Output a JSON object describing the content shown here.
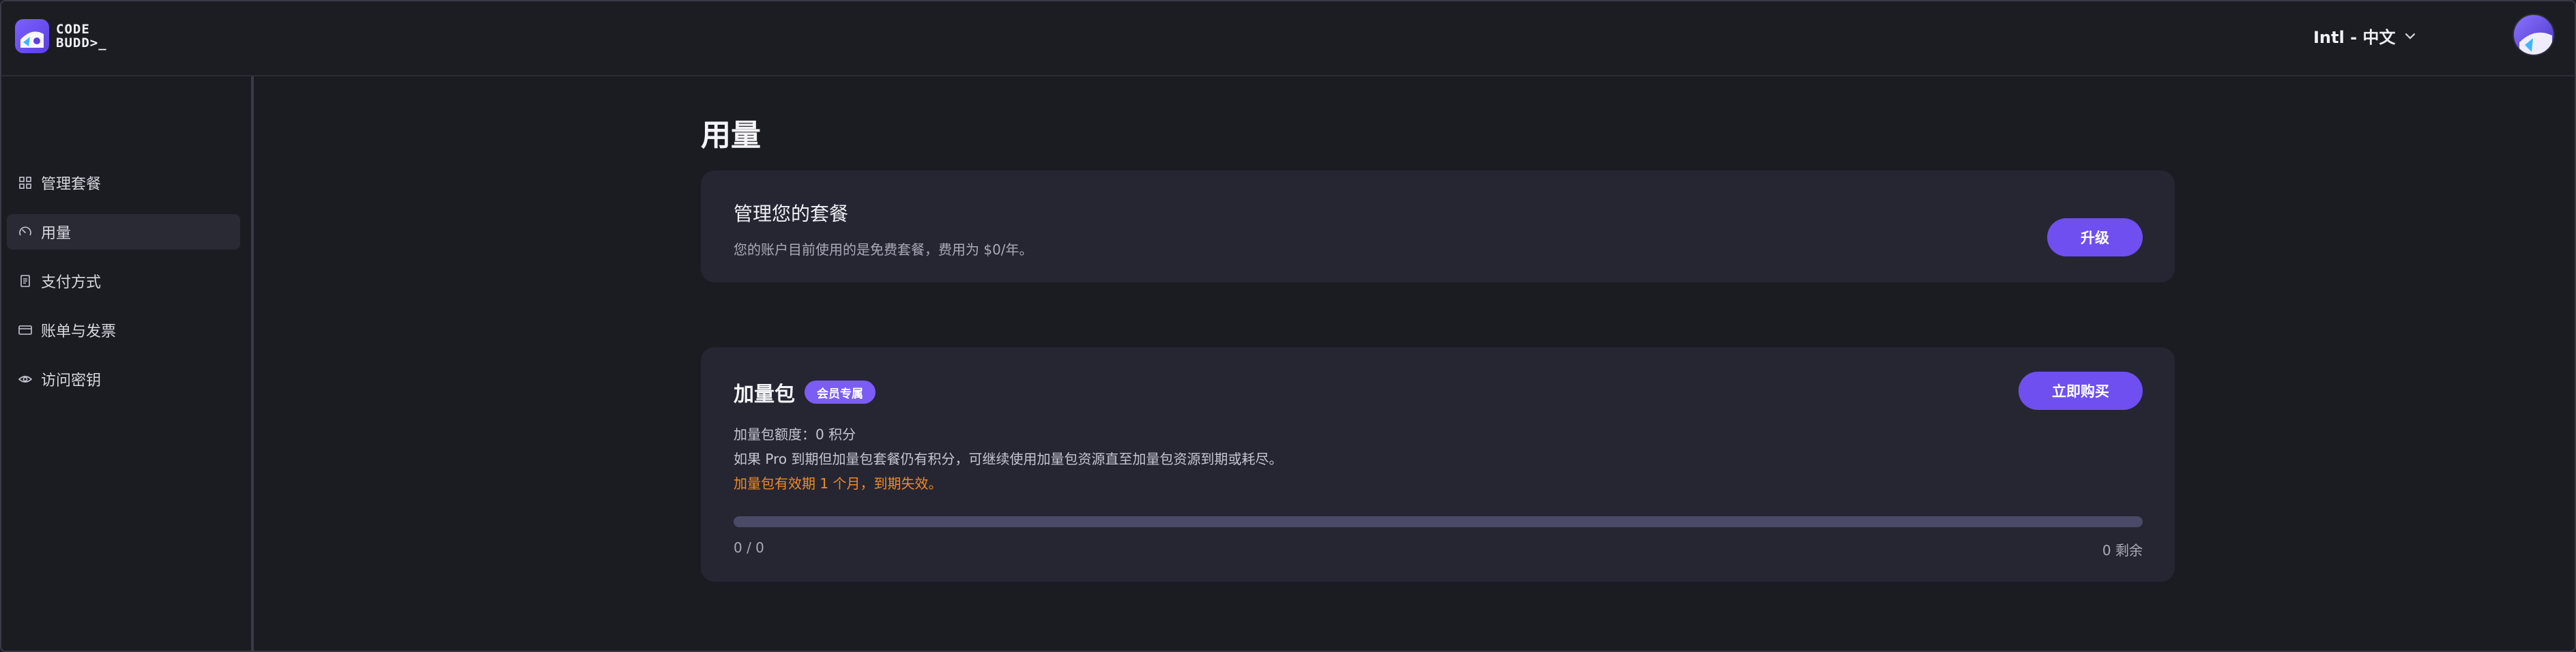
{
  "header": {
    "logo_line1": "CODE",
    "logo_line2": "BUDD>_",
    "language": "Intl - 中文",
    "icons": [
      "logo-icon",
      "chevron-down-icon",
      "avatar-icon"
    ]
  },
  "sidebar": {
    "items": [
      {
        "label": "管理套餐",
        "icon": "grid-icon"
      },
      {
        "label": "用量",
        "icon": "gauge-icon",
        "active": true
      },
      {
        "label": "支付方式",
        "icon": "receipt-icon"
      },
      {
        "label": "账单与发票",
        "icon": "card-icon"
      },
      {
        "label": "访问密钥",
        "icon": "eye-icon"
      }
    ]
  },
  "main": {
    "title": "用量",
    "plan_card": {
      "title": "管理您的套餐",
      "subtitle": "您的账户目前使用的是免费套餐，费用为 $0/年。",
      "upgrade_label": "升级"
    },
    "addon_card": {
      "title": "加量包",
      "badge": "会员专属",
      "buy_label": "立即购买",
      "quota_line": "加量包额度：0 积分",
      "info_line": "如果 Pro 到期但加量包套餐仍有积分，可继续使用加量包资源直至加量包资源到期或耗尽。",
      "warning_line": "加量包有效期 1 个月，到期失效。",
      "progress_text": "0 / 0",
      "remaining_text": "0 剩余",
      "progress_fraction": 0
    }
  },
  "colors": {
    "accent": "#6f4ff0",
    "warning": "#f08a24",
    "card_bg": "#262633",
    "page_bg": "#1b1b22"
  }
}
